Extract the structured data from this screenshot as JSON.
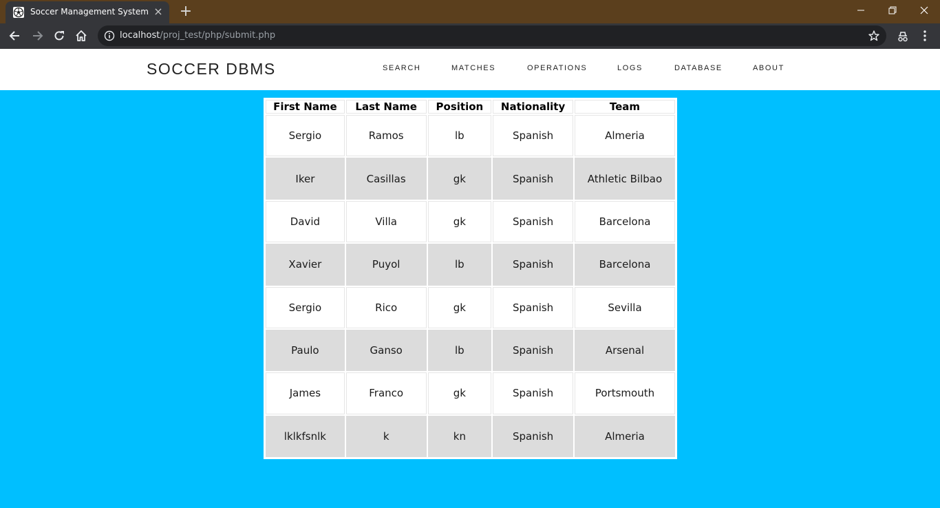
{
  "browser": {
    "tab_title": "Soccer Management System",
    "url_host": "localhost",
    "url_path": "/proj_test/php/submit.php"
  },
  "site": {
    "brand": "SOCCER DBMS",
    "nav": [
      "SEARCH",
      "MATCHES",
      "OPERATIONS",
      "LOGS",
      "DATABASE",
      "ABOUT"
    ]
  },
  "table": {
    "headers": [
      "First Name",
      "Last Name",
      "Position",
      "Nationality",
      "Team"
    ],
    "rows": [
      [
        "Sergio",
        "Ramos",
        "lb",
        "Spanish",
        "Almeria"
      ],
      [
        "Iker",
        "Casillas",
        "gk",
        "Spanish",
        "Athletic Bilbao"
      ],
      [
        "David",
        "Villa",
        "gk",
        "Spanish",
        "Barcelona"
      ],
      [
        "Xavier",
        "Puyol",
        "lb",
        "Spanish",
        "Barcelona"
      ],
      [
        "Sergio",
        "Rico",
        "gk",
        "Spanish",
        "Sevilla"
      ],
      [
        "Paulo",
        "Ganso",
        "lb",
        "Spanish",
        "Arsenal"
      ],
      [
        "James",
        "Franco",
        "gk",
        "Spanish",
        "Portsmouth"
      ],
      [
        "lklkfsnlk",
        "k",
        "kn",
        "Spanish",
        "Almeria"
      ]
    ]
  },
  "colors": {
    "page_background": "#00bfff",
    "titlebar": "#5b3f1d",
    "toolbar": "#35363a",
    "row_alt": "#dcdcdc"
  }
}
